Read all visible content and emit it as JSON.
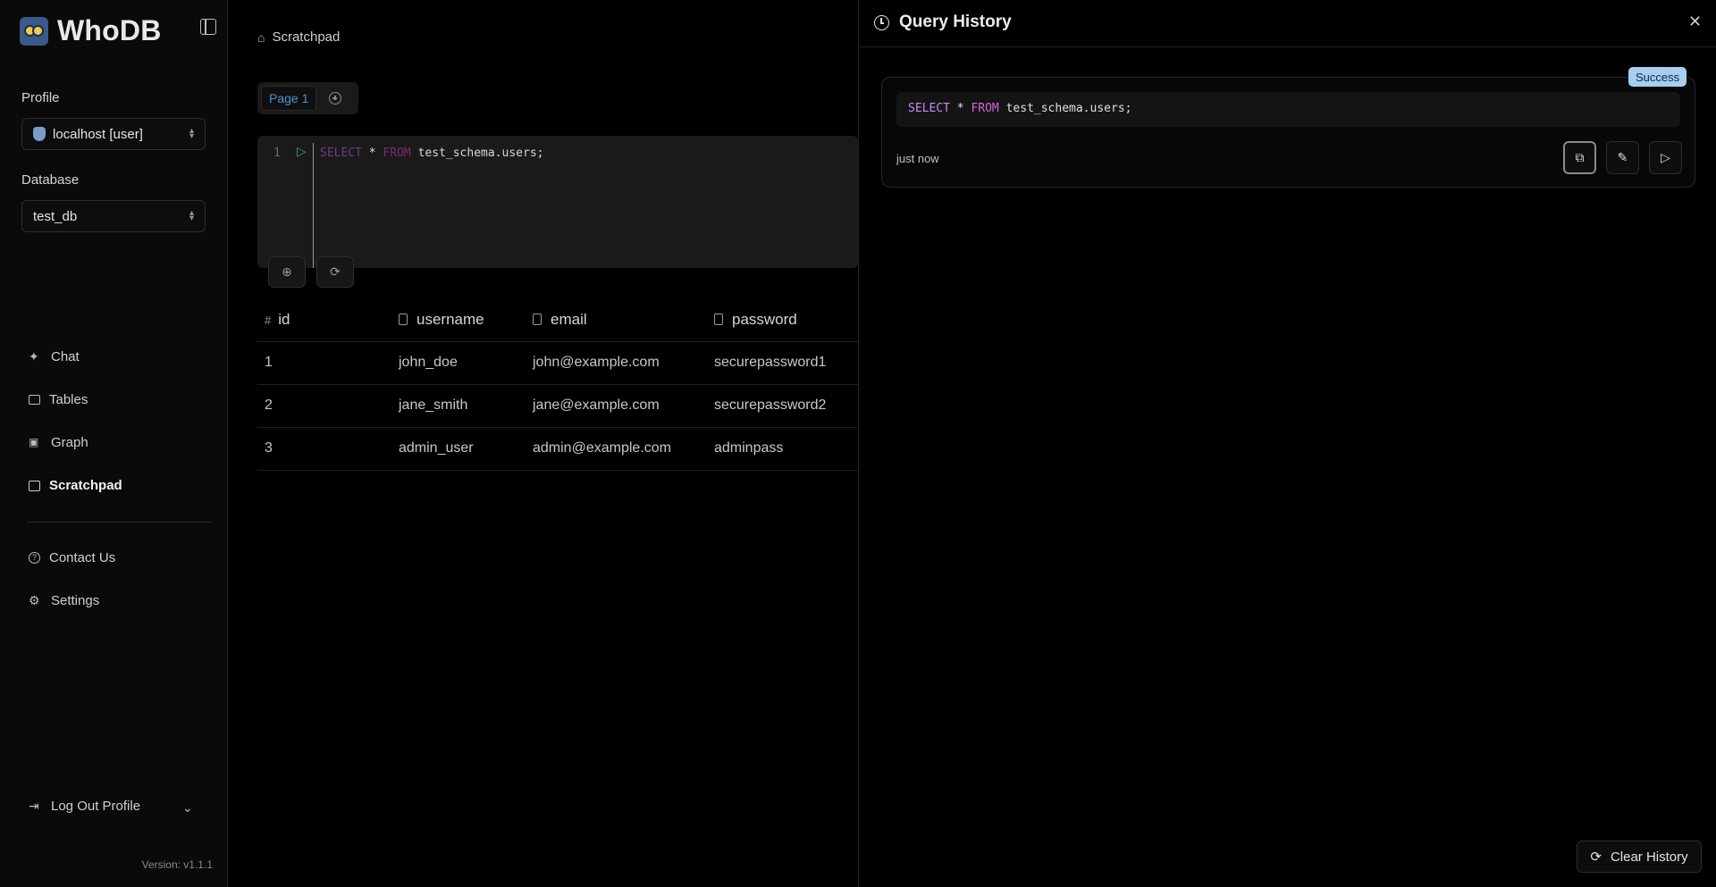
{
  "sidebar": {
    "app_name": "WhoDB",
    "profile_label": "Profile",
    "profile_value": "localhost [user]",
    "database_label": "Database",
    "database_value": "test_db",
    "nav": [
      {
        "label": "Chat",
        "icon": "sparkles-icon"
      },
      {
        "label": "Tables",
        "icon": "table-icon"
      },
      {
        "label": "Graph",
        "icon": "graph-icon"
      },
      {
        "label": "Scratchpad",
        "icon": "scratchpad-icon",
        "active": true
      }
    ],
    "secondary_nav": [
      {
        "label": "Contact Us",
        "icon": "help-icon"
      },
      {
        "label": "Settings",
        "icon": "gear-icon"
      }
    ],
    "logout_label": "Log Out Profile",
    "version": "Version: v1.1.1"
  },
  "main": {
    "breadcrumb": "Scratchpad",
    "page_tab": "Page 1",
    "editor": {
      "line_number": "1",
      "kw_select": "SELECT",
      "star": " * ",
      "kw_from": "FROM",
      "rest": " test_schema.users;"
    },
    "table": {
      "columns": [
        "id",
        "username",
        "email",
        "password"
      ],
      "rows": [
        [
          "1",
          "john_doe",
          "john@example.com",
          "securepassword1"
        ],
        [
          "2",
          "jane_smith",
          "jane@example.com",
          "securepassword2"
        ],
        [
          "3",
          "admin_user",
          "admin@example.com",
          "adminpass"
        ]
      ]
    }
  },
  "history": {
    "title": "Query History",
    "entry": {
      "status": "Success",
      "kw_select": "SELECT",
      "star": " * ",
      "kw_from": "FROM",
      "rest": " test_schema.users;",
      "time": "just now"
    },
    "clear_label": "Clear History"
  },
  "colors": {
    "accent": "#4f90d6",
    "success_badge": "#a8cdf0",
    "run_green": "#3aa76d"
  }
}
